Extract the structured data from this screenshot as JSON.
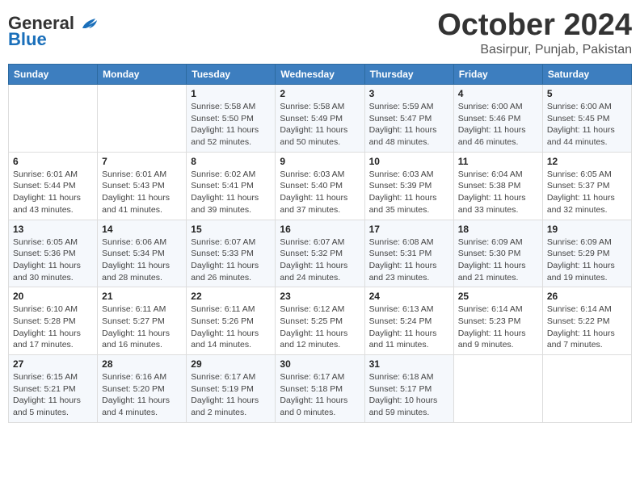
{
  "header": {
    "logo_general": "General",
    "logo_blue": "Blue",
    "month": "October 2024",
    "location": "Basirpur, Punjab, Pakistan"
  },
  "days_of_week": [
    "Sunday",
    "Monday",
    "Tuesday",
    "Wednesday",
    "Thursday",
    "Friday",
    "Saturday"
  ],
  "weeks": [
    [
      {
        "day": "",
        "sunrise": "",
        "sunset": "",
        "daylight": ""
      },
      {
        "day": "",
        "sunrise": "",
        "sunset": "",
        "daylight": ""
      },
      {
        "day": "1",
        "sunrise": "Sunrise: 5:58 AM",
        "sunset": "Sunset: 5:50 PM",
        "daylight": "Daylight: 11 hours and 52 minutes."
      },
      {
        "day": "2",
        "sunrise": "Sunrise: 5:58 AM",
        "sunset": "Sunset: 5:49 PM",
        "daylight": "Daylight: 11 hours and 50 minutes."
      },
      {
        "day": "3",
        "sunrise": "Sunrise: 5:59 AM",
        "sunset": "Sunset: 5:47 PM",
        "daylight": "Daylight: 11 hours and 48 minutes."
      },
      {
        "day": "4",
        "sunrise": "Sunrise: 6:00 AM",
        "sunset": "Sunset: 5:46 PM",
        "daylight": "Daylight: 11 hours and 46 minutes."
      },
      {
        "day": "5",
        "sunrise": "Sunrise: 6:00 AM",
        "sunset": "Sunset: 5:45 PM",
        "daylight": "Daylight: 11 hours and 44 minutes."
      }
    ],
    [
      {
        "day": "6",
        "sunrise": "Sunrise: 6:01 AM",
        "sunset": "Sunset: 5:44 PM",
        "daylight": "Daylight: 11 hours and 43 minutes."
      },
      {
        "day": "7",
        "sunrise": "Sunrise: 6:01 AM",
        "sunset": "Sunset: 5:43 PM",
        "daylight": "Daylight: 11 hours and 41 minutes."
      },
      {
        "day": "8",
        "sunrise": "Sunrise: 6:02 AM",
        "sunset": "Sunset: 5:41 PM",
        "daylight": "Daylight: 11 hours and 39 minutes."
      },
      {
        "day": "9",
        "sunrise": "Sunrise: 6:03 AM",
        "sunset": "Sunset: 5:40 PM",
        "daylight": "Daylight: 11 hours and 37 minutes."
      },
      {
        "day": "10",
        "sunrise": "Sunrise: 6:03 AM",
        "sunset": "Sunset: 5:39 PM",
        "daylight": "Daylight: 11 hours and 35 minutes."
      },
      {
        "day": "11",
        "sunrise": "Sunrise: 6:04 AM",
        "sunset": "Sunset: 5:38 PM",
        "daylight": "Daylight: 11 hours and 33 minutes."
      },
      {
        "day": "12",
        "sunrise": "Sunrise: 6:05 AM",
        "sunset": "Sunset: 5:37 PM",
        "daylight": "Daylight: 11 hours and 32 minutes."
      }
    ],
    [
      {
        "day": "13",
        "sunrise": "Sunrise: 6:05 AM",
        "sunset": "Sunset: 5:36 PM",
        "daylight": "Daylight: 11 hours and 30 minutes."
      },
      {
        "day": "14",
        "sunrise": "Sunrise: 6:06 AM",
        "sunset": "Sunset: 5:34 PM",
        "daylight": "Daylight: 11 hours and 28 minutes."
      },
      {
        "day": "15",
        "sunrise": "Sunrise: 6:07 AM",
        "sunset": "Sunset: 5:33 PM",
        "daylight": "Daylight: 11 hours and 26 minutes."
      },
      {
        "day": "16",
        "sunrise": "Sunrise: 6:07 AM",
        "sunset": "Sunset: 5:32 PM",
        "daylight": "Daylight: 11 hours and 24 minutes."
      },
      {
        "day": "17",
        "sunrise": "Sunrise: 6:08 AM",
        "sunset": "Sunset: 5:31 PM",
        "daylight": "Daylight: 11 hours and 23 minutes."
      },
      {
        "day": "18",
        "sunrise": "Sunrise: 6:09 AM",
        "sunset": "Sunset: 5:30 PM",
        "daylight": "Daylight: 11 hours and 21 minutes."
      },
      {
        "day": "19",
        "sunrise": "Sunrise: 6:09 AM",
        "sunset": "Sunset: 5:29 PM",
        "daylight": "Daylight: 11 hours and 19 minutes."
      }
    ],
    [
      {
        "day": "20",
        "sunrise": "Sunrise: 6:10 AM",
        "sunset": "Sunset: 5:28 PM",
        "daylight": "Daylight: 11 hours and 17 minutes."
      },
      {
        "day": "21",
        "sunrise": "Sunrise: 6:11 AM",
        "sunset": "Sunset: 5:27 PM",
        "daylight": "Daylight: 11 hours and 16 minutes."
      },
      {
        "day": "22",
        "sunrise": "Sunrise: 6:11 AM",
        "sunset": "Sunset: 5:26 PM",
        "daylight": "Daylight: 11 hours and 14 minutes."
      },
      {
        "day": "23",
        "sunrise": "Sunrise: 6:12 AM",
        "sunset": "Sunset: 5:25 PM",
        "daylight": "Daylight: 11 hours and 12 minutes."
      },
      {
        "day": "24",
        "sunrise": "Sunrise: 6:13 AM",
        "sunset": "Sunset: 5:24 PM",
        "daylight": "Daylight: 11 hours and 11 minutes."
      },
      {
        "day": "25",
        "sunrise": "Sunrise: 6:14 AM",
        "sunset": "Sunset: 5:23 PM",
        "daylight": "Daylight: 11 hours and 9 minutes."
      },
      {
        "day": "26",
        "sunrise": "Sunrise: 6:14 AM",
        "sunset": "Sunset: 5:22 PM",
        "daylight": "Daylight: 11 hours and 7 minutes."
      }
    ],
    [
      {
        "day": "27",
        "sunrise": "Sunrise: 6:15 AM",
        "sunset": "Sunset: 5:21 PM",
        "daylight": "Daylight: 11 hours and 5 minutes."
      },
      {
        "day": "28",
        "sunrise": "Sunrise: 6:16 AM",
        "sunset": "Sunset: 5:20 PM",
        "daylight": "Daylight: 11 hours and 4 minutes."
      },
      {
        "day": "29",
        "sunrise": "Sunrise: 6:17 AM",
        "sunset": "Sunset: 5:19 PM",
        "daylight": "Daylight: 11 hours and 2 minutes."
      },
      {
        "day": "30",
        "sunrise": "Sunrise: 6:17 AM",
        "sunset": "Sunset: 5:18 PM",
        "daylight": "Daylight: 11 hours and 0 minutes."
      },
      {
        "day": "31",
        "sunrise": "Sunrise: 6:18 AM",
        "sunset": "Sunset: 5:17 PM",
        "daylight": "Daylight: 10 hours and 59 minutes."
      },
      {
        "day": "",
        "sunrise": "",
        "sunset": "",
        "daylight": ""
      },
      {
        "day": "",
        "sunrise": "",
        "sunset": "",
        "daylight": ""
      }
    ]
  ]
}
